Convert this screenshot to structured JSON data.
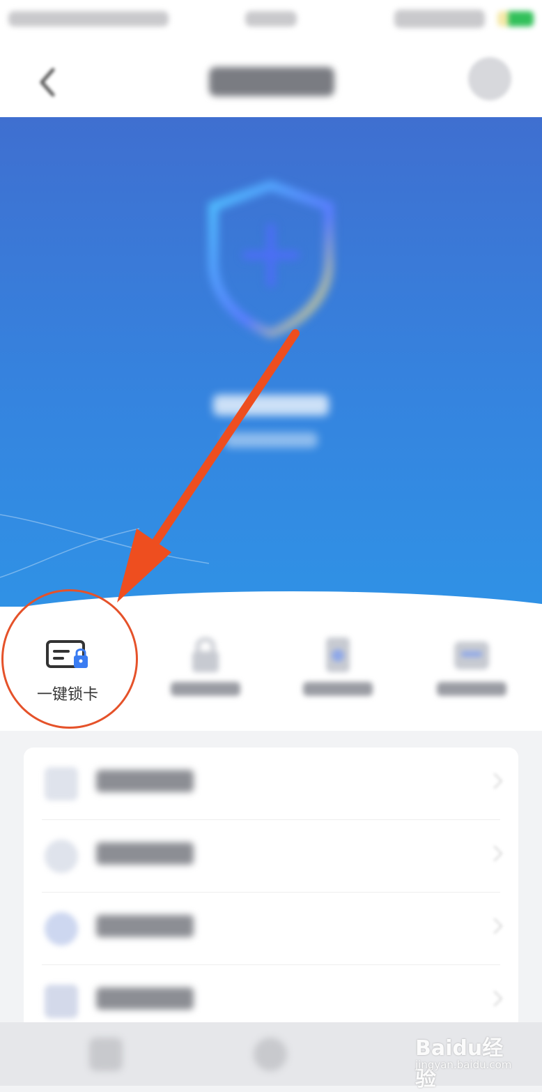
{
  "quick_actions": {
    "lock_card": {
      "label": "一键锁卡"
    }
  },
  "watermark": {
    "brand": "Baidu经验",
    "url": "jingyan.baidu.com"
  },
  "colors": {
    "banner_top": "#3f6fd0",
    "banner_bottom": "#2f93e6",
    "annotation": "#e5522a",
    "lock_accent": "#3a7cf2"
  }
}
